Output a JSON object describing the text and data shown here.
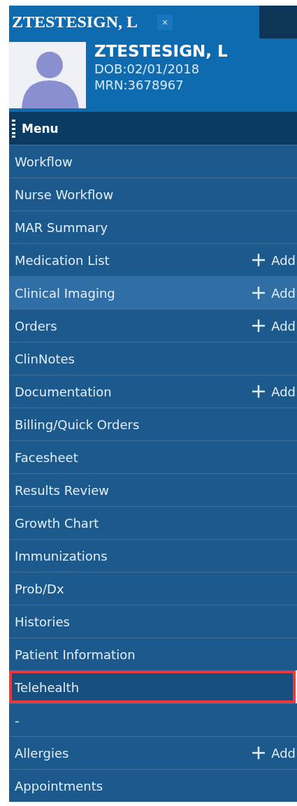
{
  "tab": {
    "title": "ZTESTESIGN, L",
    "close": "×"
  },
  "patient": {
    "name": "ZTESTESIGN, L",
    "dob": "DOB:02/01/2018",
    "mrn": "MRN:3678967"
  },
  "menu": {
    "title": "Menu",
    "items": [
      {
        "label": "Workflow",
        "selected": false,
        "highlighted": false
      },
      {
        "label": "Nurse Workflow",
        "selected": false,
        "highlighted": false
      },
      {
        "label": "MAR Summary",
        "selected": false,
        "highlighted": false
      },
      {
        "label": "Medication List",
        "add": "Add",
        "selected": false,
        "highlighted": false
      },
      {
        "label": "Clinical Imaging",
        "add": "Add",
        "selected": true,
        "highlighted": false
      },
      {
        "label": "Orders",
        "add": "Add",
        "selected": false,
        "highlighted": false
      },
      {
        "label": "ClinNotes",
        "selected": false,
        "highlighted": false
      },
      {
        "label": "Documentation",
        "add": "Add",
        "selected": false,
        "highlighted": false
      },
      {
        "label": "Billing/Quick Orders",
        "selected": false,
        "highlighted": false
      },
      {
        "label": "Facesheet",
        "selected": false,
        "highlighted": false
      },
      {
        "label": "Results Review",
        "selected": false,
        "highlighted": false
      },
      {
        "label": "Growth Chart",
        "selected": false,
        "highlighted": false
      },
      {
        "label": "Immunizations",
        "selected": false,
        "highlighted": false
      },
      {
        "label": "Prob/Dx",
        "selected": false,
        "highlighted": false
      },
      {
        "label": "Histories",
        "selected": false,
        "highlighted": false
      },
      {
        "label": "Patient Information",
        "selected": false,
        "highlighted": false
      },
      {
        "label": "Telehealth",
        "selected": false,
        "highlighted": true
      },
      {
        "label": "-",
        "selected": false,
        "highlighted": false
      },
      {
        "label": "Allergies",
        "add": "Add",
        "selected": false,
        "highlighted": false
      },
      {
        "label": "Appointments",
        "selected": false,
        "highlighted": false
      }
    ]
  }
}
